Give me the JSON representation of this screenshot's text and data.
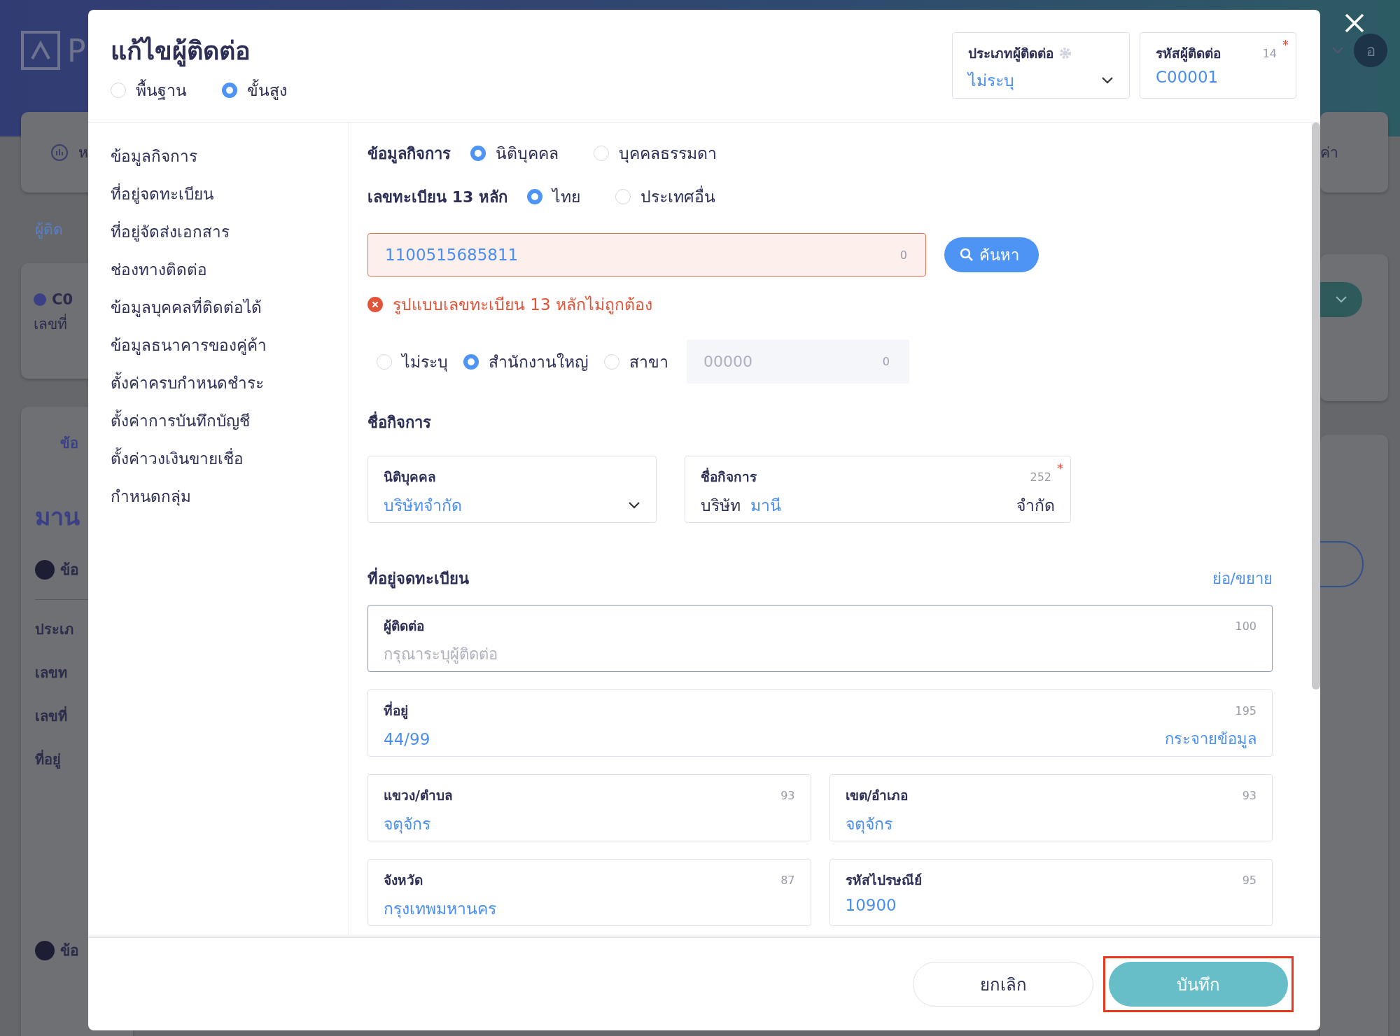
{
  "background": {
    "logo_letter": "P",
    "left_card_text": "ห",
    "breadcrumb": "ผู้ติด",
    "code_fragment": "C0",
    "number_fragment": "เลขที่",
    "tab_fragment": "ข้อ",
    "name_fragment": "มาน",
    "section_fragments": [
      "ข้อ",
      "ข้อ"
    ],
    "row_fragments": [
      "ประเภ",
      "เลขท",
      "เลขที่",
      "ที่อยู่"
    ],
    "avatar": "อ",
    "right_card_text": "ค่า"
  },
  "title": "แก้ไขผู้ติดต่อ",
  "mode_options": [
    {
      "label": "พื้นฐาน",
      "selected": false
    },
    {
      "label": "ขั้นสูง",
      "selected": true
    }
  ],
  "contact_type": {
    "label": "ประเภทผู้ติดต่อ",
    "value": "ไม่ระบุ"
  },
  "contact_code": {
    "label": "รหัสผู้ติดต่อ",
    "count": "14",
    "required_mark": "*",
    "value": "C00001"
  },
  "sidebar": [
    "ข้อมูลกิจการ",
    "ที่อยู่จดทะเบียน",
    "ที่อยู่จัดส่งเอกสาร",
    "ช่องทางติดต่อ",
    "ข้อมูลบุคคลที่ติดต่อได้",
    "ข้อมูลธนาคารของคู่ค้า",
    "ตั้งค่าครบกำหนดชำระ",
    "ตั้งค่าการบันทึกบัญชี",
    "ตั้งค่าวงเงินขายเชื่อ",
    "กำหนดกลุ่ม"
  ],
  "business": {
    "label": "ข้อมูลกิจการ",
    "options": [
      {
        "label": "นิติบุคคล",
        "selected": true
      },
      {
        "label": "บุคคลธรรมดา",
        "selected": false
      }
    ]
  },
  "registration": {
    "label": "เลขทะเบียน 13 หลัก",
    "options": [
      {
        "label": "ไทย",
        "selected": true
      },
      {
        "label": "ประเทศอื่น",
        "selected": false
      }
    ],
    "input": {
      "value": "1100515685811",
      "count": "0",
      "invalid": true
    },
    "search_button": "ค้นหา",
    "error": "รูปแบบเลขทะเบียน 13 หลักไม่ถูกต้อง"
  },
  "branch": {
    "options": [
      {
        "label": "ไม่ระบุ",
        "selected": false
      },
      {
        "label": "สำนักงานใหญ่",
        "selected": true
      },
      {
        "label": "สาขา",
        "selected": false
      }
    ],
    "code_field": {
      "placeholder": "00000",
      "count": "0"
    }
  },
  "business_name": {
    "heading": "ชื่อกิจการ",
    "legal_type": {
      "label": "นิติบุคคล",
      "value": "บริษัทจำกัด"
    },
    "name": {
      "label": "ชื่อกิจการ",
      "count": "252",
      "required_mark": "*",
      "prefix": "บริษัท",
      "value": "มานี",
      "suffix": "จำกัด"
    }
  },
  "address": {
    "heading": "ที่อยู่จดทะเบียน",
    "toggle_link": "ย่อ/ขยาย",
    "rows": [
      [
        {
          "label": "ผู้ติดต่อ",
          "count": "100",
          "placeholder": "กรุณาระบุผู้ติดต่อ",
          "focused": true
        }
      ],
      [
        {
          "label": "ที่อยู่",
          "count": "195",
          "value": "44/99",
          "link": "กระจายข้อมูล",
          "focused": false
        }
      ],
      [
        {
          "label": "แขวง/ตำบล",
          "count": "93",
          "value": "จตุจักร",
          "focused": false
        },
        {
          "label": "เขต/อำเภอ",
          "count": "93",
          "value": "จตุจักร",
          "focused": false
        }
      ],
      [
        {
          "label": "จังหวัด",
          "count": "87",
          "value": "กรุงเทพมหานคร",
          "focused": false
        },
        {
          "label": "รหัสไปรษณีย์",
          "count": "95",
          "value": "10900",
          "focused": false
        }
      ]
    ]
  },
  "footer": {
    "cancel": "ยกเลิก",
    "save": "บันทึก",
    "save_highlighted": true
  }
}
